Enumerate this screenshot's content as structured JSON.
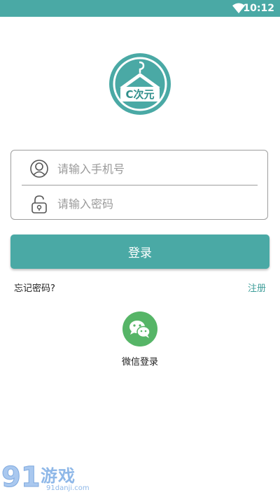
{
  "status_bar": {
    "time": "10:12"
  },
  "logo": {
    "text": "C次元"
  },
  "login": {
    "phone_placeholder": "请输入手机号",
    "password_placeholder": "请输入密码",
    "login_button": "登录",
    "forgot_password": "忘记密码?",
    "register": "注册"
  },
  "third_party": {
    "wechat_label": "微信登录"
  },
  "watermark": {
    "title": "游戏",
    "site": "91danji.com"
  },
  "colors": {
    "accent": "#4aa9a5",
    "wechat": "#56b567"
  }
}
